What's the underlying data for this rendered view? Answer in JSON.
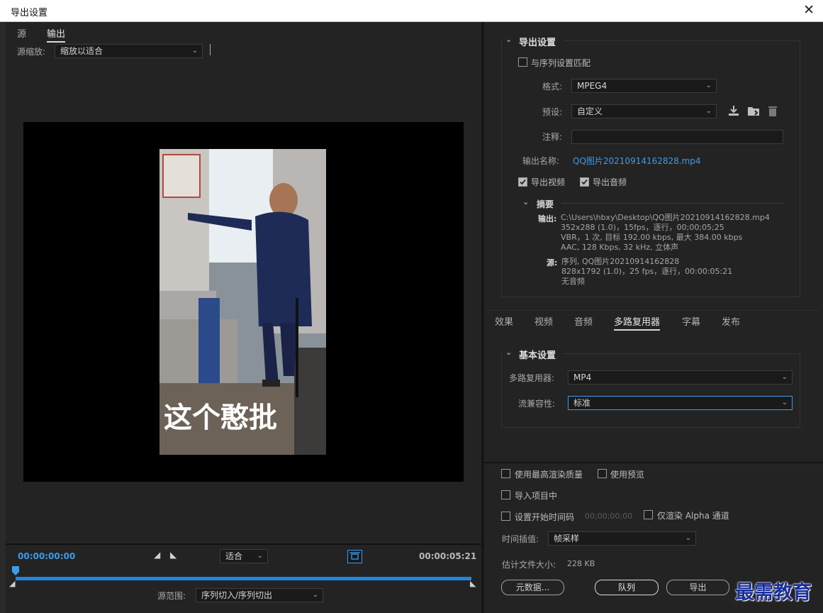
{
  "window": {
    "title": "导出设置",
    "close_glyph": "✕"
  },
  "left": {
    "tabs": [
      "源",
      "输出"
    ],
    "source_scale_label": "源缩放:",
    "source_scale_value": "缩放以适合",
    "caption_text": "这个憨批",
    "timeline": {
      "start_tc": "00:00:00:00",
      "end_tc": "00:00:05:21",
      "fit_value": "适合",
      "range_label": "源范围:",
      "range_value": "序列切入/序列切出"
    }
  },
  "export_settings": {
    "header": "导出设置",
    "match_sequence_label": "与序列设置匹配",
    "format_label": "格式:",
    "format_value": "MPEG4",
    "preset_label": "预设:",
    "preset_value": "自定义",
    "comment_label": "注释:",
    "comment_value": "",
    "output_name_label": "输出名称:",
    "output_name_value": "QQ图片20210914162828.mp4",
    "export_video_label": "导出视频",
    "export_audio_label": "导出音频",
    "summary_header": "摘要",
    "summary_output_label": "输出:",
    "summary_output_lines": [
      "C:\\Users\\hbxy\\Desktop\\QQ图片20210914162828.mp4",
      "352x288 (1.0)，15fps，逐行，00;00;05;25",
      "VBR，1 次, 目标 192.00 kbps, 最大 384.00 kbps",
      "AAC, 128 Kbps, 32  kHz, 立体声"
    ],
    "summary_source_label": "源:",
    "summary_source_lines": [
      "序列, QQ图片20210914162828",
      "828x1792 (1.0)，25 fps，逐行，00:00:05:21",
      "无音频"
    ]
  },
  "tabs": [
    "效果",
    "视频",
    "音频",
    "多路复用器",
    "字幕",
    "发布"
  ],
  "basic_settings": {
    "header": "基本设置",
    "mux_label": "多路复用器:",
    "mux_value": "MP4",
    "compat_label": "流兼容性:",
    "compat_value": "标准"
  },
  "bottom": {
    "max_render_label": "使用最高渲染质量",
    "use_preview_label": "使用预览",
    "import_label": "导入项目中",
    "start_tc_label": "设置开始时间码",
    "start_tc_value": "00;00;00;00",
    "alpha_label": "仅渲染 Alpha 通道",
    "interp_label": "时间插值:",
    "interp_value": "帧采样",
    "est_size_label": "估计文件大小:",
    "est_size_value": "228 KB",
    "metadata_btn": "元数据...",
    "queue_btn": "队列",
    "export_btn": "导出"
  },
  "watermark": "最需教育",
  "colors": {
    "accent": "#3e9be8",
    "panel": "#232323"
  }
}
